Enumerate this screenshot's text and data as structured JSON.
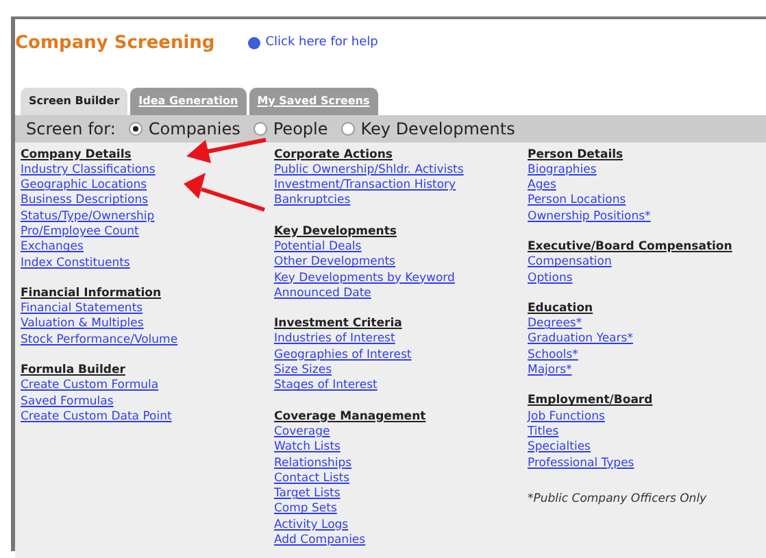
{
  "title": "Company Screening",
  "help_link": "Click here for help",
  "tabs": [
    {
      "label": "Screen Builder",
      "selected": true
    },
    {
      "label": "Idea Generation",
      "selected": false
    },
    {
      "label": "My Saved Screens",
      "selected": false
    }
  ],
  "screen_for": {
    "label": "Screen for:",
    "options": [
      {
        "label": "Companies",
        "selected": true
      },
      {
        "label": "People",
        "selected": false
      },
      {
        "label": "Key Developments",
        "selected": false
      }
    ]
  },
  "columns": [
    [
      {
        "heading": "Company Details",
        "links": [
          "Industry Classifications",
          "Geographic Locations",
          "Business Descriptions",
          "Status/Type/Ownership",
          "Pro/Employee Count",
          "Exchanges",
          "Index Constituents"
        ]
      },
      {
        "heading": "Financial Information",
        "links": [
          "Financial Statements",
          "Valuation & Multiples",
          "Stock Performance/Volume"
        ]
      },
      {
        "heading": "Formula Builder",
        "links": [
          "Create Custom Formula",
          "Saved Formulas",
          "Create Custom Data Point"
        ]
      }
    ],
    [
      {
        "heading": "Corporate Actions",
        "links": [
          "Public Ownership/Shldr. Activists",
          "Investment/Transaction History",
          "Bankruptcies"
        ]
      },
      {
        "heading": "Key Developments",
        "links": [
          "Potential Deals",
          "Other Developments",
          "Key Developments by Keyword",
          "Announced Date"
        ]
      },
      {
        "heading": "Investment Criteria",
        "links": [
          "Industries of Interest",
          "Geographies of Interest",
          "Size Sizes",
          "Stages of Interest"
        ]
      },
      {
        "heading": "Coverage Management",
        "links": [
          "Coverage",
          "Watch Lists",
          "Relationships",
          "Contact Lists",
          "Target Lists",
          "Comp Sets",
          "Activity Logs",
          "Add Companies"
        ]
      }
    ],
    [
      {
        "heading": "Person Details",
        "links": [
          "Biographies",
          "Ages",
          "Person Locations",
          "Ownership Positions*"
        ]
      },
      {
        "heading": "Executive/Board Compensation",
        "links": [
          "Compensation",
          "Options"
        ]
      },
      {
        "heading": "Education",
        "links": [
          "Degrees*",
          "Graduation Years*",
          "Schools*",
          "Majors*"
        ]
      },
      {
        "heading": "Employment/Board",
        "links": [
          "Job Functions",
          "Titles",
          "Specialties",
          "Professional Types"
        ]
      }
    ]
  ],
  "footnote": "*Public Company Officers Only"
}
